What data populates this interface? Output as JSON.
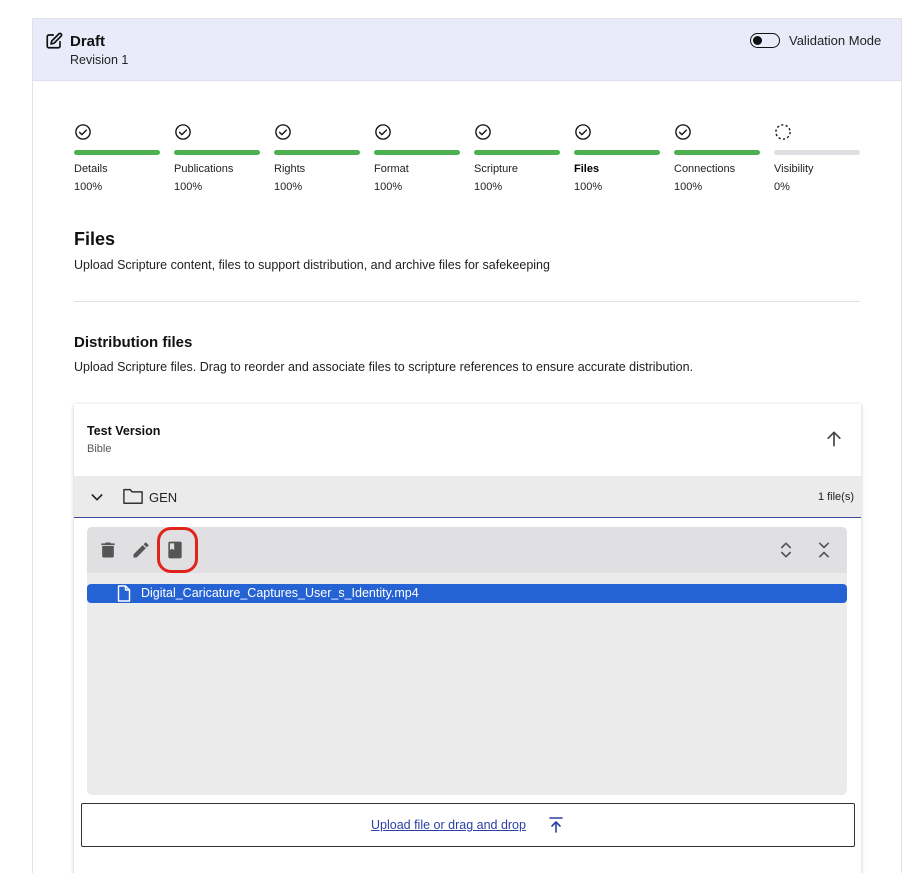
{
  "header": {
    "title": "Draft",
    "revision": "Revision 1",
    "validation_label": "Validation Mode",
    "validation_on": false
  },
  "steps": [
    {
      "label": "Details",
      "percent": "100%",
      "complete": true,
      "active": false
    },
    {
      "label": "Publications",
      "percent": "100%",
      "complete": true,
      "active": false
    },
    {
      "label": "Rights",
      "percent": "100%",
      "complete": true,
      "active": false
    },
    {
      "label": "Format",
      "percent": "100%",
      "complete": true,
      "active": false
    },
    {
      "label": "Scripture",
      "percent": "100%",
      "complete": true,
      "active": false
    },
    {
      "label": "Files",
      "percent": "100%",
      "complete": true,
      "active": true
    },
    {
      "label": "Connections",
      "percent": "100%",
      "complete": true,
      "active": false
    },
    {
      "label": "Visibility",
      "percent": "0%",
      "complete": false,
      "active": false
    }
  ],
  "section": {
    "title": "Files",
    "description": "Upload Scripture content, files to support distribution, and archive files for safekeeping"
  },
  "distribution": {
    "title": "Distribution files",
    "description": "Upload Scripture files. Drag to reorder and associate files to scripture references to ensure accurate distribution."
  },
  "card": {
    "title": "Test Version",
    "subtitle": "Bible",
    "folder": {
      "name": "GEN",
      "count": "1 file(s)",
      "files": [
        "Digital_Caricature_Captures_User_s_Identity.mp4"
      ]
    },
    "upload_label": "Upload file or drag and drop"
  },
  "icons": {
    "draft": "edit-icon",
    "toolbar": [
      "trash-icon",
      "pencil-icon",
      "book-icon",
      "expand-all-icon",
      "collapse-all-icon"
    ]
  },
  "colors": {
    "header_bg": "#e9ebfa",
    "progress_complete": "#4caf50",
    "progress_empty": "#dedee3",
    "selected_file": "#2563d4",
    "highlight": "#e0241b",
    "link": "#2b3fa8"
  }
}
